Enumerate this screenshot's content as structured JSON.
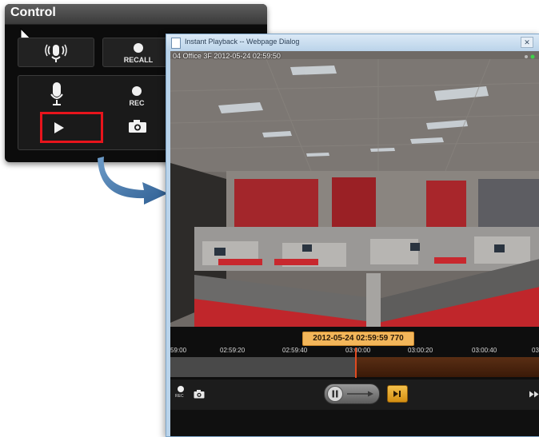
{
  "control_panel": {
    "title": "Control",
    "recall_label": "RECALL",
    "rec_label": "REC",
    "highlight_color": "#e8141c",
    "icons": [
      "wireless-mic-icon",
      "record-dot-icon",
      "microphone-icon",
      "play-icon",
      "camera-icon"
    ]
  },
  "playback_dialog": {
    "title": "Instant Playback -- Webpage Dialog",
    "close_label": "✕",
    "video_overlay": "04 Office 3F  2012-05-24 02:59:50",
    "current_timestamp": "2012-05-24 02:59:59 770",
    "timeline_ticks": [
      "59:00",
      "02:59:20",
      "02:59:40",
      "03:00:00",
      "03:00:20",
      "03:00:40",
      "03"
    ],
    "rec_small_label": "REC",
    "playhead_position_fraction": 0.5,
    "colors": {
      "badge": "#f3b65a",
      "future_track": "#5a2e14",
      "playhead": "#e04a20",
      "next_button": "#e6a020"
    },
    "icons": [
      "page-icon",
      "rec-dot-icon",
      "snapshot-icon",
      "pause-icon",
      "next-frame-icon",
      "fast-forward-icon"
    ]
  }
}
